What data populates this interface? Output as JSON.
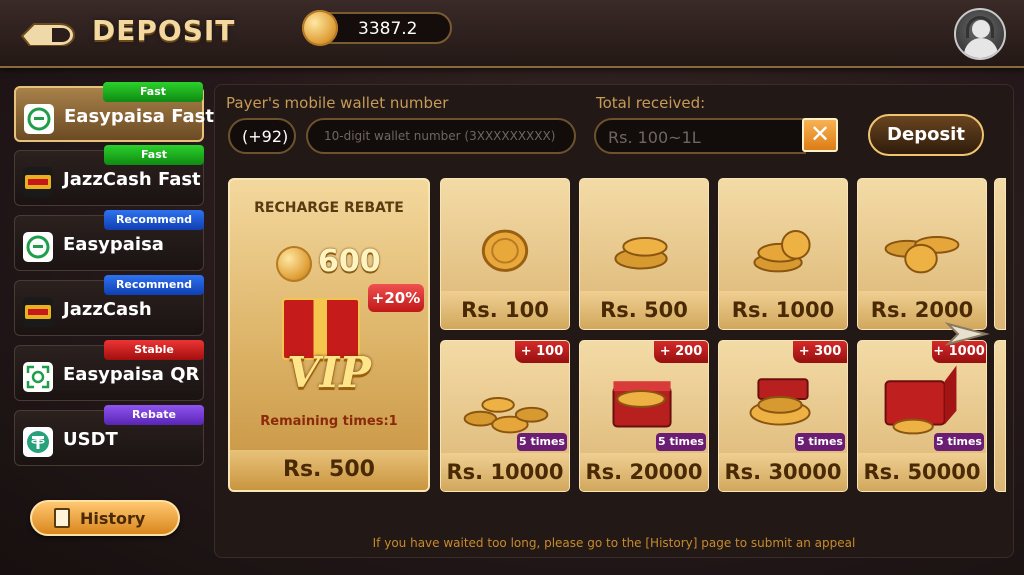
{
  "header": {
    "title": "DEPOSIT",
    "balance": "3387.2"
  },
  "sidebar": {
    "methods": [
      {
        "label": "Easypaisa Fast",
        "badge": "Fast",
        "icon": "easypaisa-icon"
      },
      {
        "label": "JazzCash Fast",
        "badge": "Fast",
        "icon": "jazzcash-icon"
      },
      {
        "label": "Easypaisa",
        "badge": "Recommend",
        "icon": "easypaisa-icon"
      },
      {
        "label": "JazzCash",
        "badge": "Recommend",
        "icon": "jazzcash-icon"
      },
      {
        "label": "Easypaisa QR",
        "badge": "Stable",
        "icon": "qr-icon"
      },
      {
        "label": "USDT",
        "badge": "Rebate",
        "icon": "tether-icon"
      }
    ],
    "history_label": "History"
  },
  "form": {
    "wallet_label": "Payer's mobile wallet number",
    "country_code": "(+92)",
    "wallet_placeholder": "10-digit wallet number (3XXXXXXXXX)",
    "total_label": "Total received:",
    "total_placeholder": "Rs.  100~1L",
    "deposit_label": "Deposit"
  },
  "rebate_card": {
    "title": "RECHARGE REBATE",
    "amount": "600",
    "bonus_pct": "+20%",
    "vip_text": "VIP",
    "remaining": "Remaining times:1",
    "price": "Rs. 500"
  },
  "amounts": [
    {
      "price": "Rs. 100",
      "bonus": "",
      "times": ""
    },
    {
      "price": "Rs. 500",
      "bonus": "",
      "times": ""
    },
    {
      "price": "Rs. 1000",
      "bonus": "",
      "times": ""
    },
    {
      "price": "Rs. 2000",
      "bonus": "",
      "times": ""
    },
    {
      "price": "Rs. 10000",
      "bonus": "+ 100",
      "times": "5 times"
    },
    {
      "price": "Rs. 20000",
      "bonus": "+ 200",
      "times": "5 times"
    },
    {
      "price": "Rs. 30000",
      "bonus": "+ 300",
      "times": "5 times"
    },
    {
      "price": "Rs. 50000",
      "bonus": "+ 1000",
      "times": "5 times"
    }
  ],
  "notice": "If you have waited too long, please go to the [History] page to submit an appeal",
  "colors": {
    "accent_gold": "#f0c470",
    "badge_fast": "#1aa81e",
    "badge_recommend": "#1f55d8",
    "badge_stable": "#d01f1f",
    "badge_rebate": "#7a3fd8"
  }
}
